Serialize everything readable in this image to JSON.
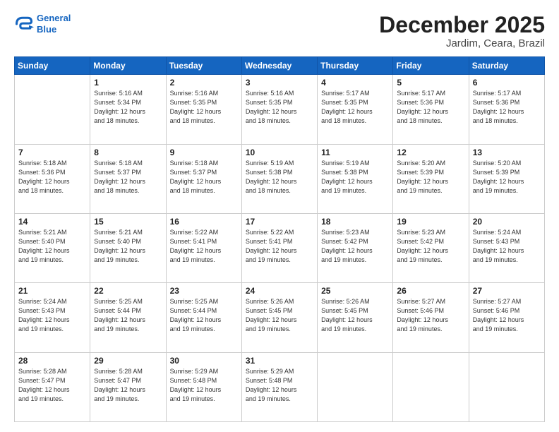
{
  "logo": {
    "line1": "General",
    "line2": "Blue"
  },
  "title": "December 2025",
  "location": "Jardim, Ceara, Brazil",
  "weekdays": [
    "Sunday",
    "Monday",
    "Tuesday",
    "Wednesday",
    "Thursday",
    "Friday",
    "Saturday"
  ],
  "weeks": [
    [
      {
        "day": "",
        "info": ""
      },
      {
        "day": "1",
        "info": "Sunrise: 5:16 AM\nSunset: 5:34 PM\nDaylight: 12 hours\nand 18 minutes."
      },
      {
        "day": "2",
        "info": "Sunrise: 5:16 AM\nSunset: 5:35 PM\nDaylight: 12 hours\nand 18 minutes."
      },
      {
        "day": "3",
        "info": "Sunrise: 5:16 AM\nSunset: 5:35 PM\nDaylight: 12 hours\nand 18 minutes."
      },
      {
        "day": "4",
        "info": "Sunrise: 5:17 AM\nSunset: 5:35 PM\nDaylight: 12 hours\nand 18 minutes."
      },
      {
        "day": "5",
        "info": "Sunrise: 5:17 AM\nSunset: 5:36 PM\nDaylight: 12 hours\nand 18 minutes."
      },
      {
        "day": "6",
        "info": "Sunrise: 5:17 AM\nSunset: 5:36 PM\nDaylight: 12 hours\nand 18 minutes."
      }
    ],
    [
      {
        "day": "7",
        "info": "Sunrise: 5:18 AM\nSunset: 5:36 PM\nDaylight: 12 hours\nand 18 minutes."
      },
      {
        "day": "8",
        "info": "Sunrise: 5:18 AM\nSunset: 5:37 PM\nDaylight: 12 hours\nand 18 minutes."
      },
      {
        "day": "9",
        "info": "Sunrise: 5:18 AM\nSunset: 5:37 PM\nDaylight: 12 hours\nand 18 minutes."
      },
      {
        "day": "10",
        "info": "Sunrise: 5:19 AM\nSunset: 5:38 PM\nDaylight: 12 hours\nand 18 minutes."
      },
      {
        "day": "11",
        "info": "Sunrise: 5:19 AM\nSunset: 5:38 PM\nDaylight: 12 hours\nand 19 minutes."
      },
      {
        "day": "12",
        "info": "Sunrise: 5:20 AM\nSunset: 5:39 PM\nDaylight: 12 hours\nand 19 minutes."
      },
      {
        "day": "13",
        "info": "Sunrise: 5:20 AM\nSunset: 5:39 PM\nDaylight: 12 hours\nand 19 minutes."
      }
    ],
    [
      {
        "day": "14",
        "info": "Sunrise: 5:21 AM\nSunset: 5:40 PM\nDaylight: 12 hours\nand 19 minutes."
      },
      {
        "day": "15",
        "info": "Sunrise: 5:21 AM\nSunset: 5:40 PM\nDaylight: 12 hours\nand 19 minutes."
      },
      {
        "day": "16",
        "info": "Sunrise: 5:22 AM\nSunset: 5:41 PM\nDaylight: 12 hours\nand 19 minutes."
      },
      {
        "day": "17",
        "info": "Sunrise: 5:22 AM\nSunset: 5:41 PM\nDaylight: 12 hours\nand 19 minutes."
      },
      {
        "day": "18",
        "info": "Sunrise: 5:23 AM\nSunset: 5:42 PM\nDaylight: 12 hours\nand 19 minutes."
      },
      {
        "day": "19",
        "info": "Sunrise: 5:23 AM\nSunset: 5:42 PM\nDaylight: 12 hours\nand 19 minutes."
      },
      {
        "day": "20",
        "info": "Sunrise: 5:24 AM\nSunset: 5:43 PM\nDaylight: 12 hours\nand 19 minutes."
      }
    ],
    [
      {
        "day": "21",
        "info": "Sunrise: 5:24 AM\nSunset: 5:43 PM\nDaylight: 12 hours\nand 19 minutes."
      },
      {
        "day": "22",
        "info": "Sunrise: 5:25 AM\nSunset: 5:44 PM\nDaylight: 12 hours\nand 19 minutes."
      },
      {
        "day": "23",
        "info": "Sunrise: 5:25 AM\nSunset: 5:44 PM\nDaylight: 12 hours\nand 19 minutes."
      },
      {
        "day": "24",
        "info": "Sunrise: 5:26 AM\nSunset: 5:45 PM\nDaylight: 12 hours\nand 19 minutes."
      },
      {
        "day": "25",
        "info": "Sunrise: 5:26 AM\nSunset: 5:45 PM\nDaylight: 12 hours\nand 19 minutes."
      },
      {
        "day": "26",
        "info": "Sunrise: 5:27 AM\nSunset: 5:46 PM\nDaylight: 12 hours\nand 19 minutes."
      },
      {
        "day": "27",
        "info": "Sunrise: 5:27 AM\nSunset: 5:46 PM\nDaylight: 12 hours\nand 19 minutes."
      }
    ],
    [
      {
        "day": "28",
        "info": "Sunrise: 5:28 AM\nSunset: 5:47 PM\nDaylight: 12 hours\nand 19 minutes."
      },
      {
        "day": "29",
        "info": "Sunrise: 5:28 AM\nSunset: 5:47 PM\nDaylight: 12 hours\nand 19 minutes."
      },
      {
        "day": "30",
        "info": "Sunrise: 5:29 AM\nSunset: 5:48 PM\nDaylight: 12 hours\nand 19 minutes."
      },
      {
        "day": "31",
        "info": "Sunrise: 5:29 AM\nSunset: 5:48 PM\nDaylight: 12 hours\nand 19 minutes."
      },
      {
        "day": "",
        "info": ""
      },
      {
        "day": "",
        "info": ""
      },
      {
        "day": "",
        "info": ""
      }
    ]
  ]
}
